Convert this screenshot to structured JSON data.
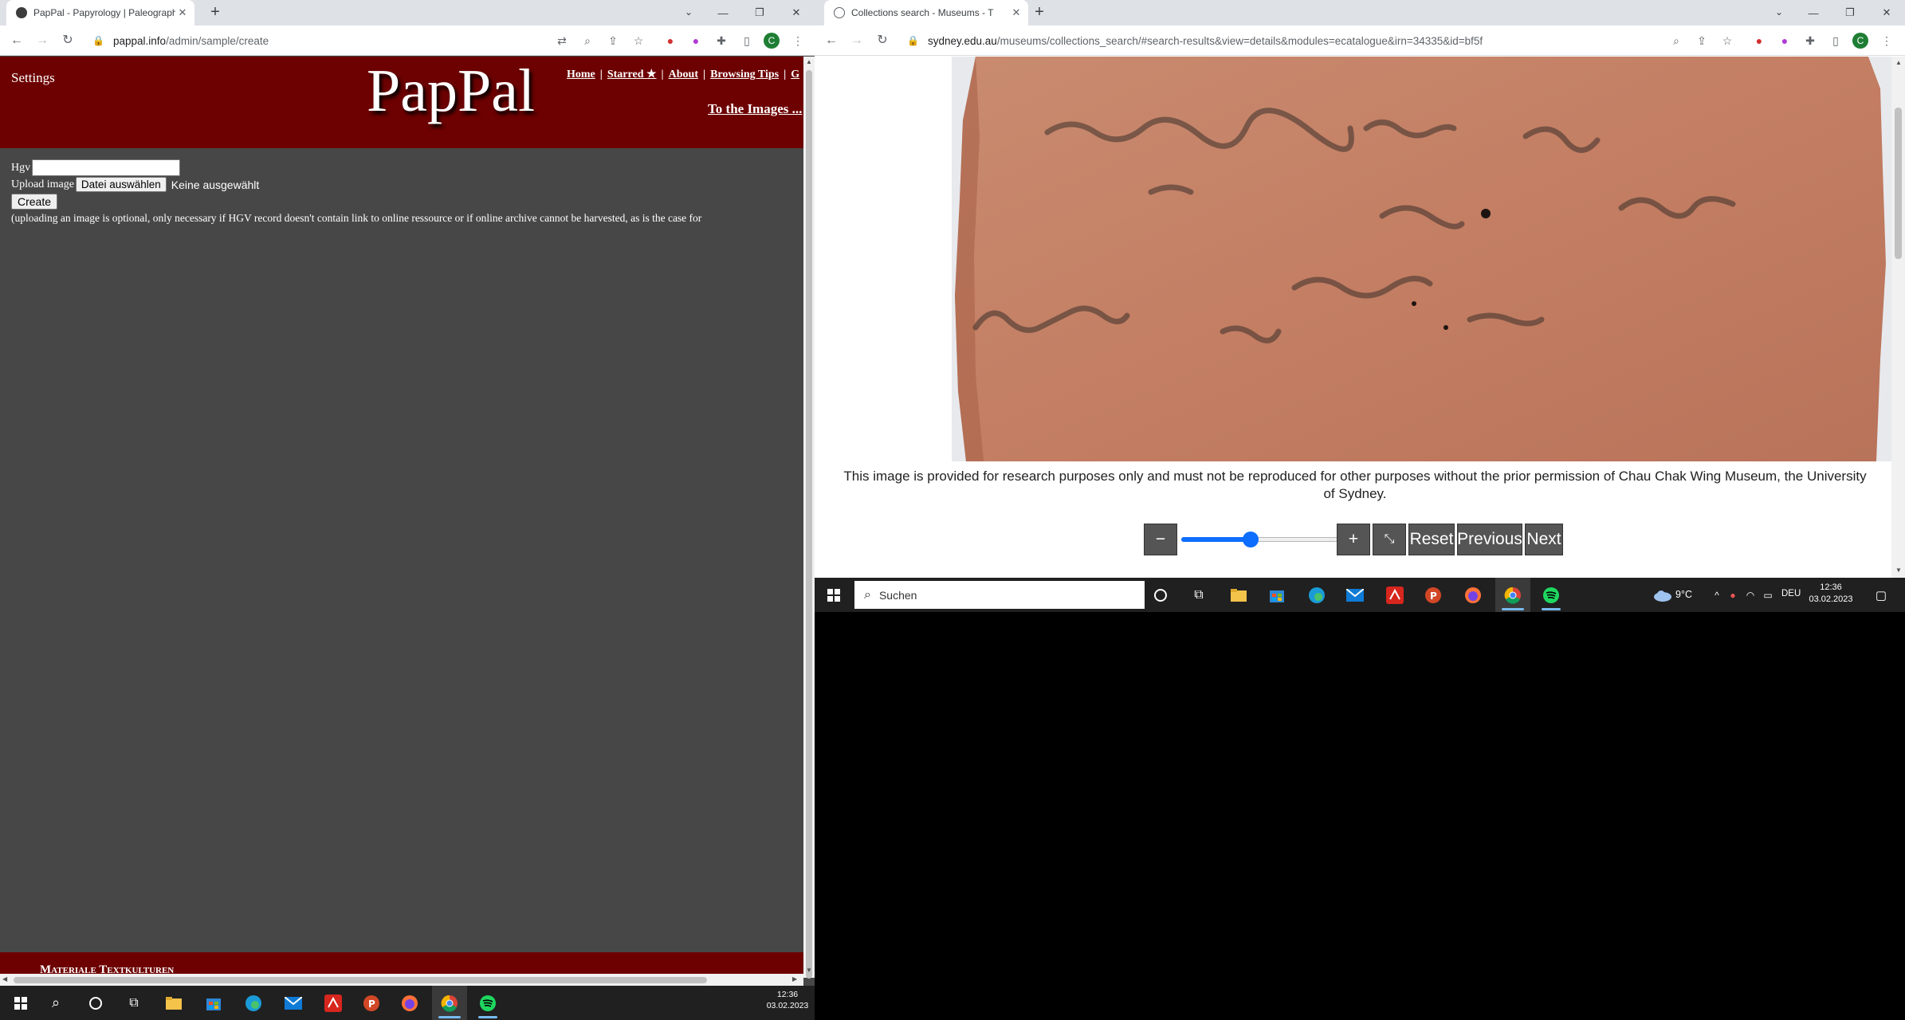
{
  "left_window": {
    "tab_title": "PapPal - Papyrology | Paleograph",
    "new_tab_symbol": "+",
    "url_host": "pappal.info",
    "url_path": "/admin/sample/create",
    "profile_initial": "C",
    "page": {
      "settings_label": "Settings",
      "logo_text": "PapPal",
      "nav_links": [
        "Home",
        "Starred ★",
        "About",
        "Browsing Tips",
        "G"
      ],
      "to_images_link": "To the Images ...",
      "hgv_label": "Hgv",
      "hgv_value": "",
      "upload_label": "Upload image",
      "file_button_label": "Datei auswählen",
      "no_file_text": "Keine ausgewählt",
      "create_button_label": "Create",
      "upload_note": "(uploading an image is optional, only necessary if HGV record doesn't contain link to online ressource or if online archive cannot be harvested, as is the case for",
      "footer_text": "Materiale Textkulturen"
    }
  },
  "right_window": {
    "tab_title": "Collections search - Museums - T",
    "new_tab_symbol": "+",
    "url_host": "sydney.edu.au",
    "url_path": "/museums/collections_search/#search-results&view=details&modules=ecatalogue&irn=34335&id=bf5f",
    "profile_initial": "C",
    "caption": "This image is provided for research purposes only and must not be reproduced for other purposes without the prior permission of Chau Chak Wing Museum, the University of Sydney.",
    "viewer": {
      "zoom_out_label": "−",
      "zoom_in_label": "+",
      "zoom_level": 0.45,
      "fit_icon": "⤡",
      "reset_label": "Reset",
      "previous_label": "Previous",
      "next_label": "Next"
    }
  },
  "taskbar_right": {
    "search_placeholder": "Suchen",
    "weather": "9°C",
    "language": "DEU",
    "time": "12:36",
    "date": "03.02.2023"
  },
  "taskbar_bottom": {
    "time": "12:36",
    "date": "03.02.2023"
  },
  "colors": {
    "pappal_red": "#6d0000",
    "page_bg": "#474747",
    "accent_blue": "#0d6efd"
  }
}
